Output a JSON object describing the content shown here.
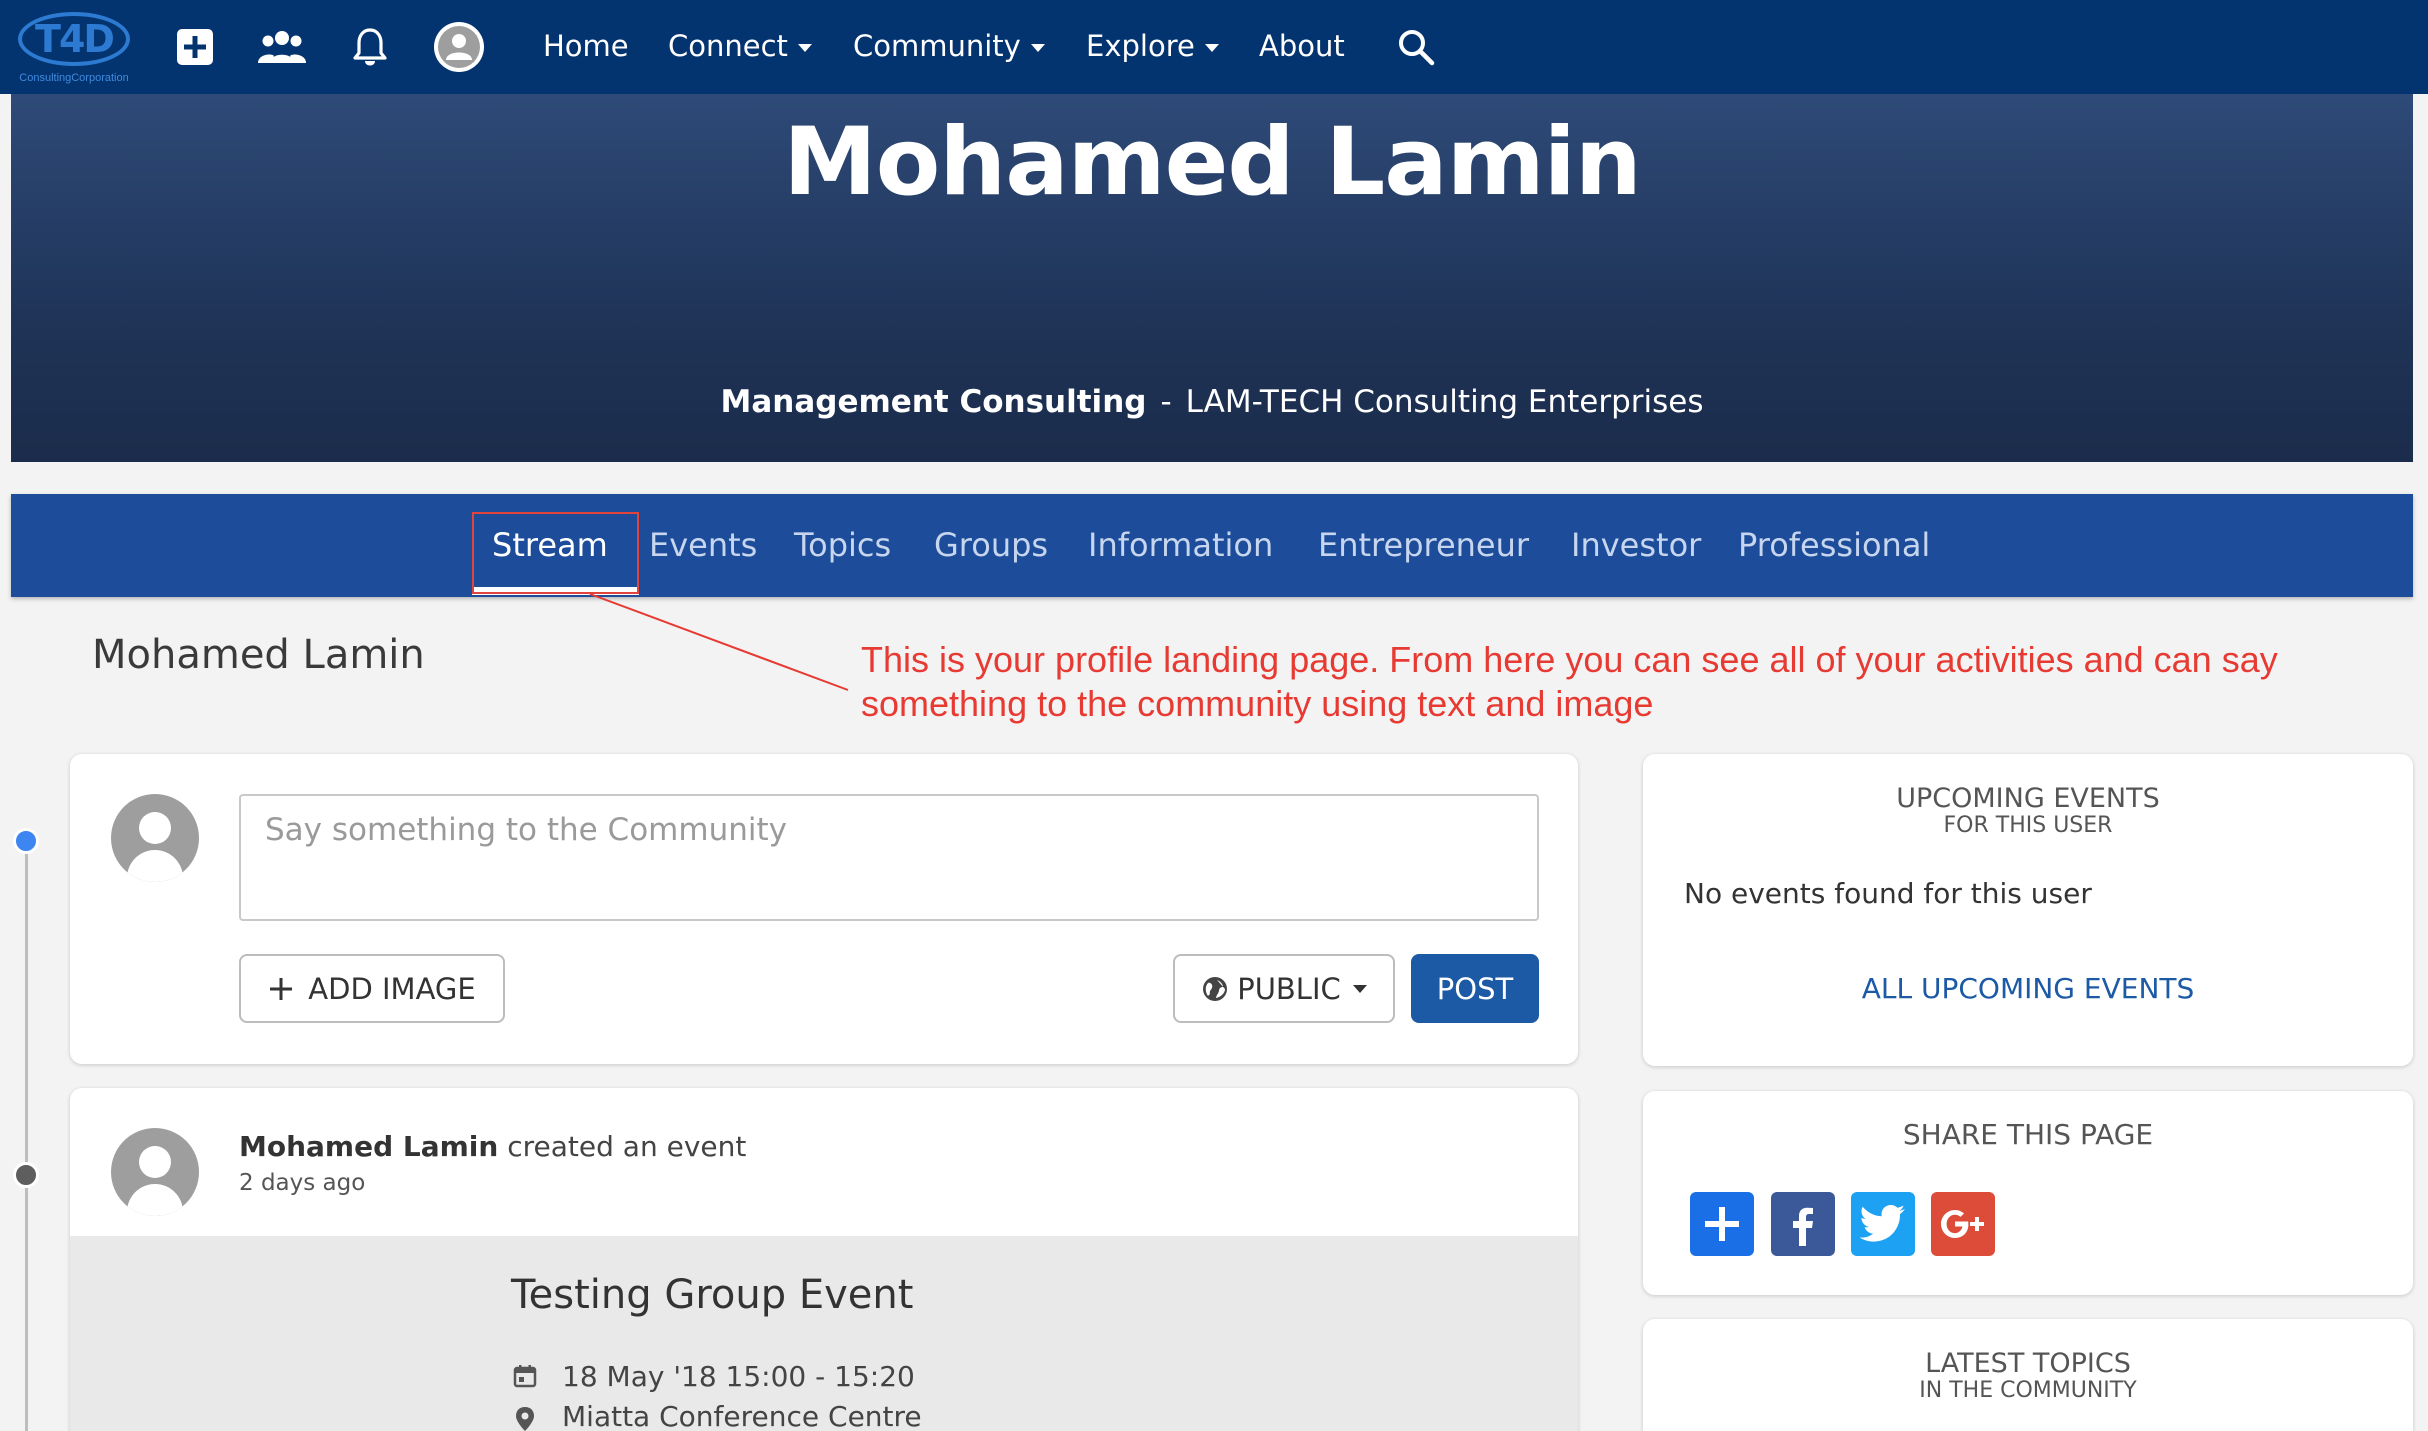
{
  "topbar": {
    "logo_text": "T4D",
    "logo_sub": "ConsultingCorporation",
    "links": {
      "home": "Home",
      "connect": "Connect",
      "community": "Community",
      "explore": "Explore",
      "about": "About"
    }
  },
  "hero": {
    "name": "Mohamed Lamin",
    "industry": "Management Consulting",
    "separator": "-",
    "company": "LAM-TECH Consulting Enterprises"
  },
  "tabs": [
    "Stream",
    "Events",
    "Topics",
    "Groups",
    "Information",
    "Entrepreneur",
    "Investor",
    "Professional"
  ],
  "annotation": "This is your profile landing page. From here you can see all of your activities and can say something to the community using text and image",
  "profile_heading": "Mohamed Lamin",
  "composer": {
    "placeholder": "Say something to the Community",
    "add_image": "ADD IMAGE",
    "visibility": "PUBLIC",
    "post": "POST"
  },
  "feed_item": {
    "author": "Mohamed Lamin",
    "action": "created an event",
    "time": "2 days ago",
    "event_title": "Testing Group Event",
    "event_date": "18 May '18 15:00 - 15:20",
    "event_location": "Miatta Conference Centre"
  },
  "sidebar": {
    "events_title": "UPCOMING EVENTS",
    "events_subtitle": "FOR THIS USER",
    "no_events": "No events found for this user",
    "all_events_link": "ALL UPCOMING EVENTS",
    "share_title": "SHARE THIS PAGE",
    "latest_title": "LATEST TOPICS",
    "latest_subtitle": "IN THE COMMUNITY"
  },
  "colors": {
    "navbar": "#04346f",
    "tabs": "#1c4c9a",
    "primary": "#1c5aa6",
    "annotation": "#e63a32",
    "timeline_active": "#3d85f0"
  },
  "icons": [
    "plus-square-icon",
    "people-icon",
    "bell-icon",
    "user-avatar-icon",
    "search-icon",
    "globe-icon",
    "calendar-icon",
    "location-pin-icon",
    "addthis-icon",
    "facebook-icon",
    "twitter-icon",
    "google-plus-icon"
  ]
}
